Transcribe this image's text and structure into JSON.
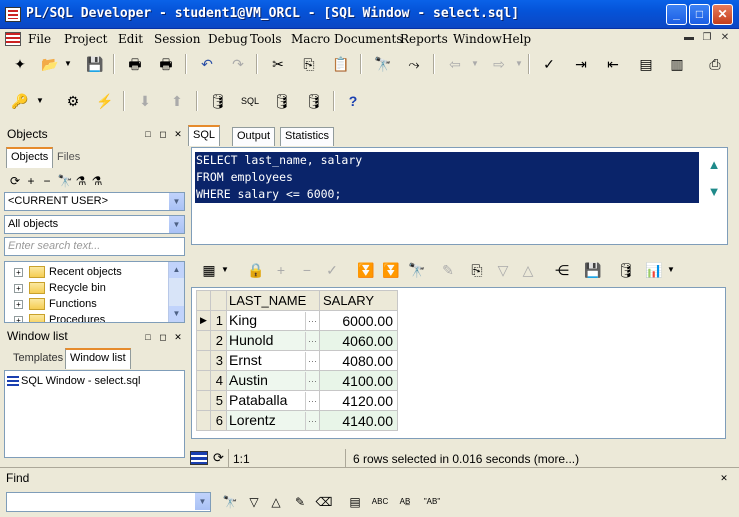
{
  "window": {
    "title": "PL/SQL Developer - student1@VM_ORCL - [SQL Window - select.sql]"
  },
  "menu": [
    "File",
    "Project",
    "Edit",
    "Session",
    "Debug",
    "Tools",
    "Macro",
    "Documents",
    "Reports",
    "Window",
    "Help"
  ],
  "objects_panel": {
    "title": "Objects",
    "tabs": [
      "Objects",
      "Files"
    ],
    "user_combo": "<CURRENT USER>",
    "filter_combo": "All objects",
    "search_placeholder": "Enter search text...",
    "tree": [
      "Recent objects",
      "Recycle bin",
      "Functions",
      "Procedures"
    ]
  },
  "windowlist_panel": {
    "title": "Window list",
    "tabs": [
      "Templates",
      "Window list"
    ],
    "items": [
      "SQL Window - select.sql"
    ]
  },
  "editor_tabs": [
    "SQL",
    "Output",
    "Statistics"
  ],
  "sql_lines": [
    "SELECT last_name, salary",
    "FROM employees",
    "WHERE salary <= 6000;"
  ],
  "grid": {
    "columns": [
      "LAST_NAME",
      "SALARY"
    ],
    "rows": [
      {
        "n": "1",
        "name": "King",
        "salary": "6000.00"
      },
      {
        "n": "2",
        "name": "Hunold",
        "salary": "4060.00"
      },
      {
        "n": "3",
        "name": "Ernst",
        "salary": "4080.00"
      },
      {
        "n": "4",
        "name": "Austin",
        "salary": "4100.00"
      },
      {
        "n": "5",
        "name": "Pataballa",
        "salary": "4120.00"
      },
      {
        "n": "6",
        "name": "Lorentz",
        "salary": "4140.00"
      }
    ]
  },
  "status": {
    "position": "1:1",
    "message": "6 rows selected in 0.016 seconds (more...)"
  },
  "find": {
    "title": "Find",
    "value": ""
  }
}
